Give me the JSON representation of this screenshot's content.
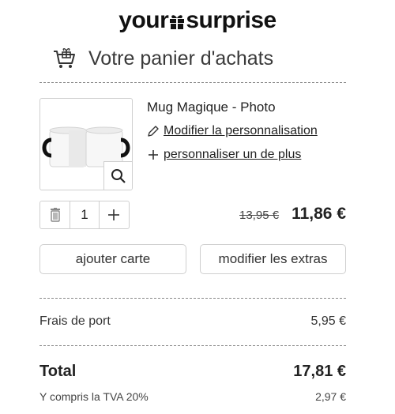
{
  "brand": {
    "logo_left": "your",
    "logo_right": "surprise"
  },
  "header": {
    "title": "Votre panier d'achats"
  },
  "product": {
    "name": "Mug Magique - Photo",
    "edit_link": "Modifier la personnalisation",
    "add_link": "personnaliser un de plus",
    "quantity": "1",
    "old_price": "13,95 €",
    "new_price": "11,86 €"
  },
  "actions": {
    "add_card": "ajouter carte",
    "edit_extras": "modifier les extras"
  },
  "summary": {
    "shipping_label": "Frais de port",
    "shipping_value": "5,95 €",
    "total_label": "Total",
    "total_value": "17,81 €",
    "tva_label": "Y compris la TVA 20%",
    "tva_value": "2,97 €"
  }
}
